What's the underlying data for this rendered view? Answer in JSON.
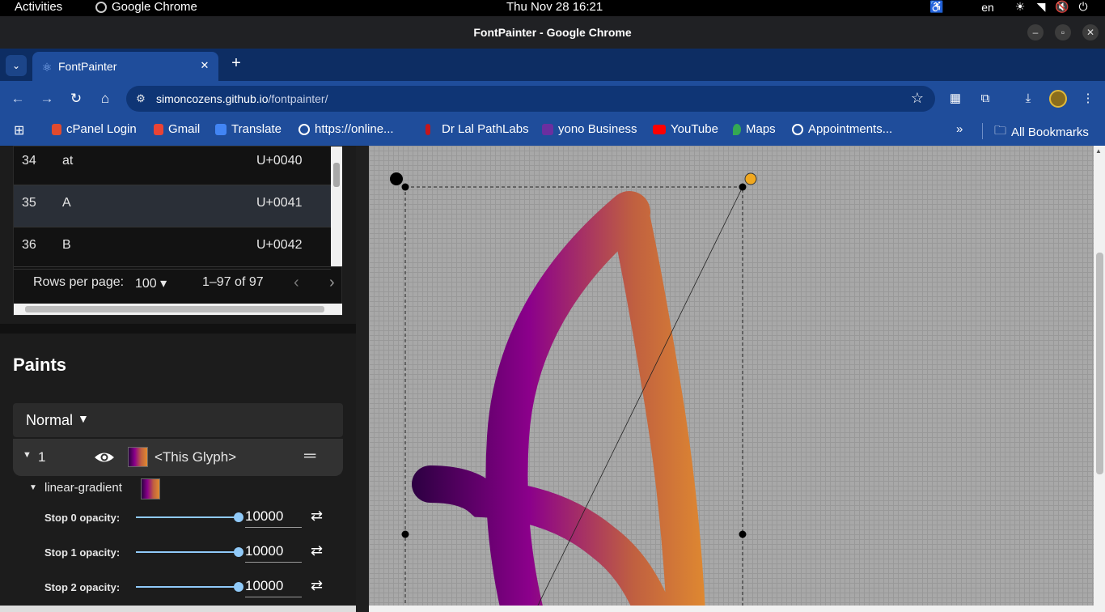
{
  "topbar": {
    "activities": "Activities",
    "app_name": "Google Chrome",
    "clock": "Thu Nov 28  16:21",
    "language": "en"
  },
  "window": {
    "title": "FontPainter - Google Chrome"
  },
  "tabs": [
    {
      "title": "FontPainter",
      "icon": "react-icon"
    }
  ],
  "omnibox": {
    "domain": "simoncozens.github.io",
    "path": "/fontpainter/"
  },
  "bookmarks": [
    {
      "label": "cPanel Login",
      "icon": "cpanel-icon",
      "color": "#e04a2f"
    },
    {
      "label": "Gmail",
      "icon": "gmail-icon",
      "color": "#ea4335"
    },
    {
      "label": "Translate",
      "icon": "translate-icon",
      "color": "#4285f4"
    },
    {
      "label": "https://online...",
      "icon": "globe-icon",
      "color": "#ffffff"
    },
    {
      "label": "Dr Lal PathLabs",
      "icon": "lalpath-icon",
      "color": "#c4161c"
    },
    {
      "label": "yono Business",
      "icon": "yono-icon",
      "color": "#6b2fa0"
    },
    {
      "label": "YouTube",
      "icon": "youtube-icon",
      "color": "#ff0000"
    },
    {
      "label": "Maps",
      "icon": "maps-icon",
      "color": "#34a853"
    },
    {
      "label": "Appointments...",
      "icon": "wordpress-icon",
      "color": "#ffffff"
    }
  ],
  "all_bookmarks": "All Bookmarks",
  "glyph_table": {
    "rows": [
      {
        "id": "34",
        "name": "at",
        "code": "U+0040"
      },
      {
        "id": "35",
        "name": "A",
        "code": "U+0041",
        "selected": true
      },
      {
        "id": "36",
        "name": "B",
        "code": "U+0042"
      }
    ],
    "rows_per_page_label": "Rows per page:",
    "rows_per_page": "100",
    "range": "1–97 of 97"
  },
  "paints": {
    "title": "Paints",
    "blend_mode": "Normal",
    "layer": {
      "index": "1",
      "source": "<This Glyph>"
    },
    "gradient_label": "linear-gradient",
    "stops": [
      {
        "label": "Stop 0 opacity:",
        "value": "10000",
        "fraction": 1.0
      },
      {
        "label": "Stop 1 opacity:",
        "value": "10000",
        "fraction": 1.0
      },
      {
        "label": "Stop 2 opacity:",
        "value": "10000",
        "fraction": 1.0
      }
    ]
  },
  "colors": {
    "chrome_blue": "#1f4d9b",
    "gradient": [
      "#2a0040",
      "#8b008b",
      "#c06040",
      "#e08a30"
    ],
    "slider": "#90caf9"
  }
}
